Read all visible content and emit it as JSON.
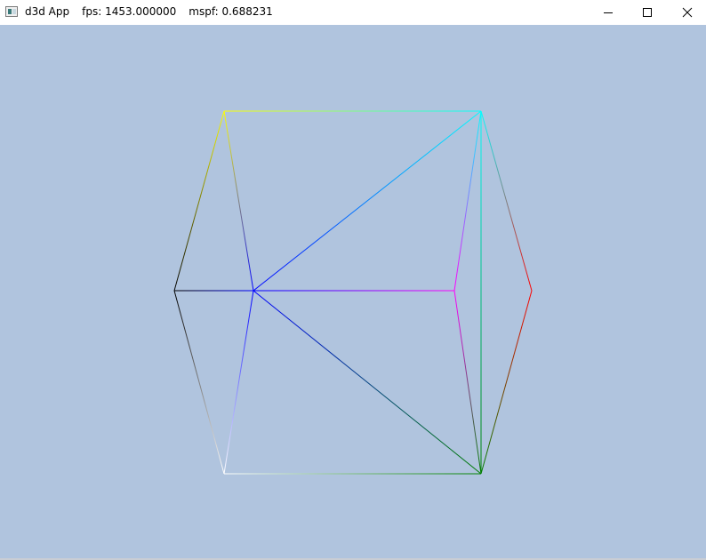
{
  "window": {
    "app_title": "d3d App",
    "fps_text": "fps: 1453.000000",
    "mspf_text": "mspf: 0.688231",
    "icon": "application-icon",
    "controls": {
      "minimize_icon": "minimize-icon",
      "maximize_icon": "maximize-icon",
      "close_icon": "close-icon"
    }
  },
  "scene": {
    "clear_color": "#b0c4de",
    "object": "wireframe cube",
    "vertex_colors": [
      "#ffffff",
      "#000000",
      "#ff0000",
      "#008000",
      "#0000ff",
      "#ffff00",
      "#00ffff",
      "#ff00ff"
    ]
  }
}
